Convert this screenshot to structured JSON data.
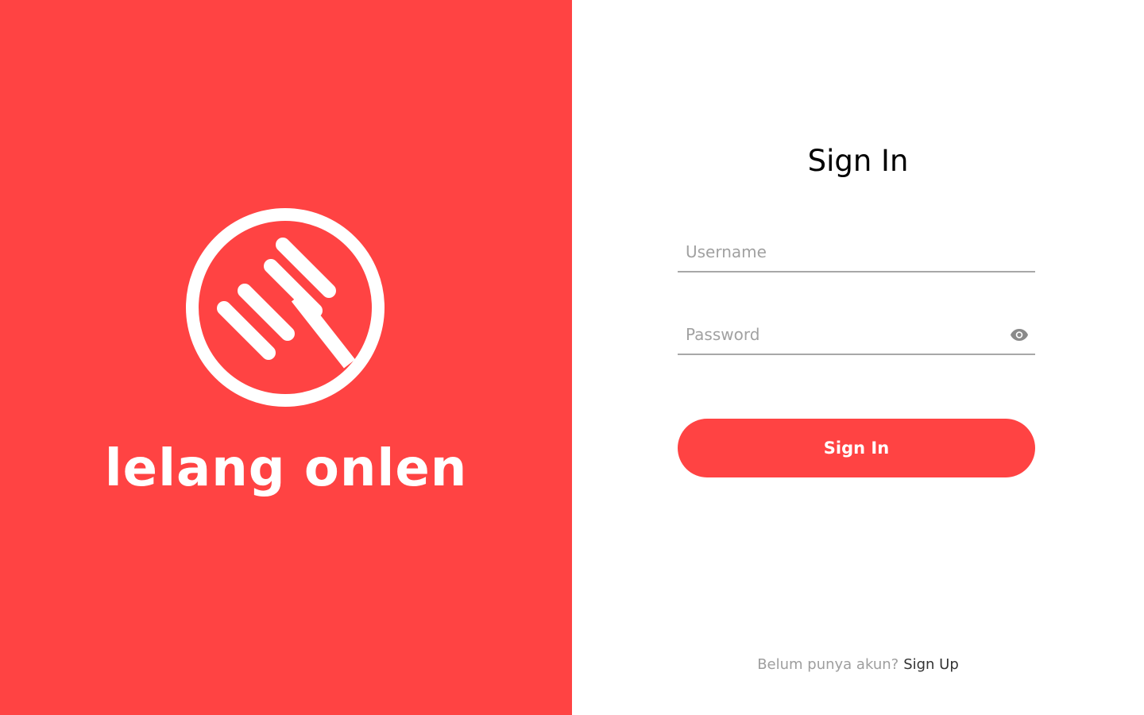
{
  "brand": {
    "name": "lelang onlen",
    "logo_icon": "gavel-circle-icon",
    "color": "#ff4343"
  },
  "form": {
    "title": "Sign In",
    "username_placeholder": "Username",
    "password_placeholder": "Password",
    "password_toggle_icon": "eye-icon",
    "submit_label": "Sign In"
  },
  "footer": {
    "prompt": "Belum punya akun?",
    "signup_label": "Sign Up"
  }
}
